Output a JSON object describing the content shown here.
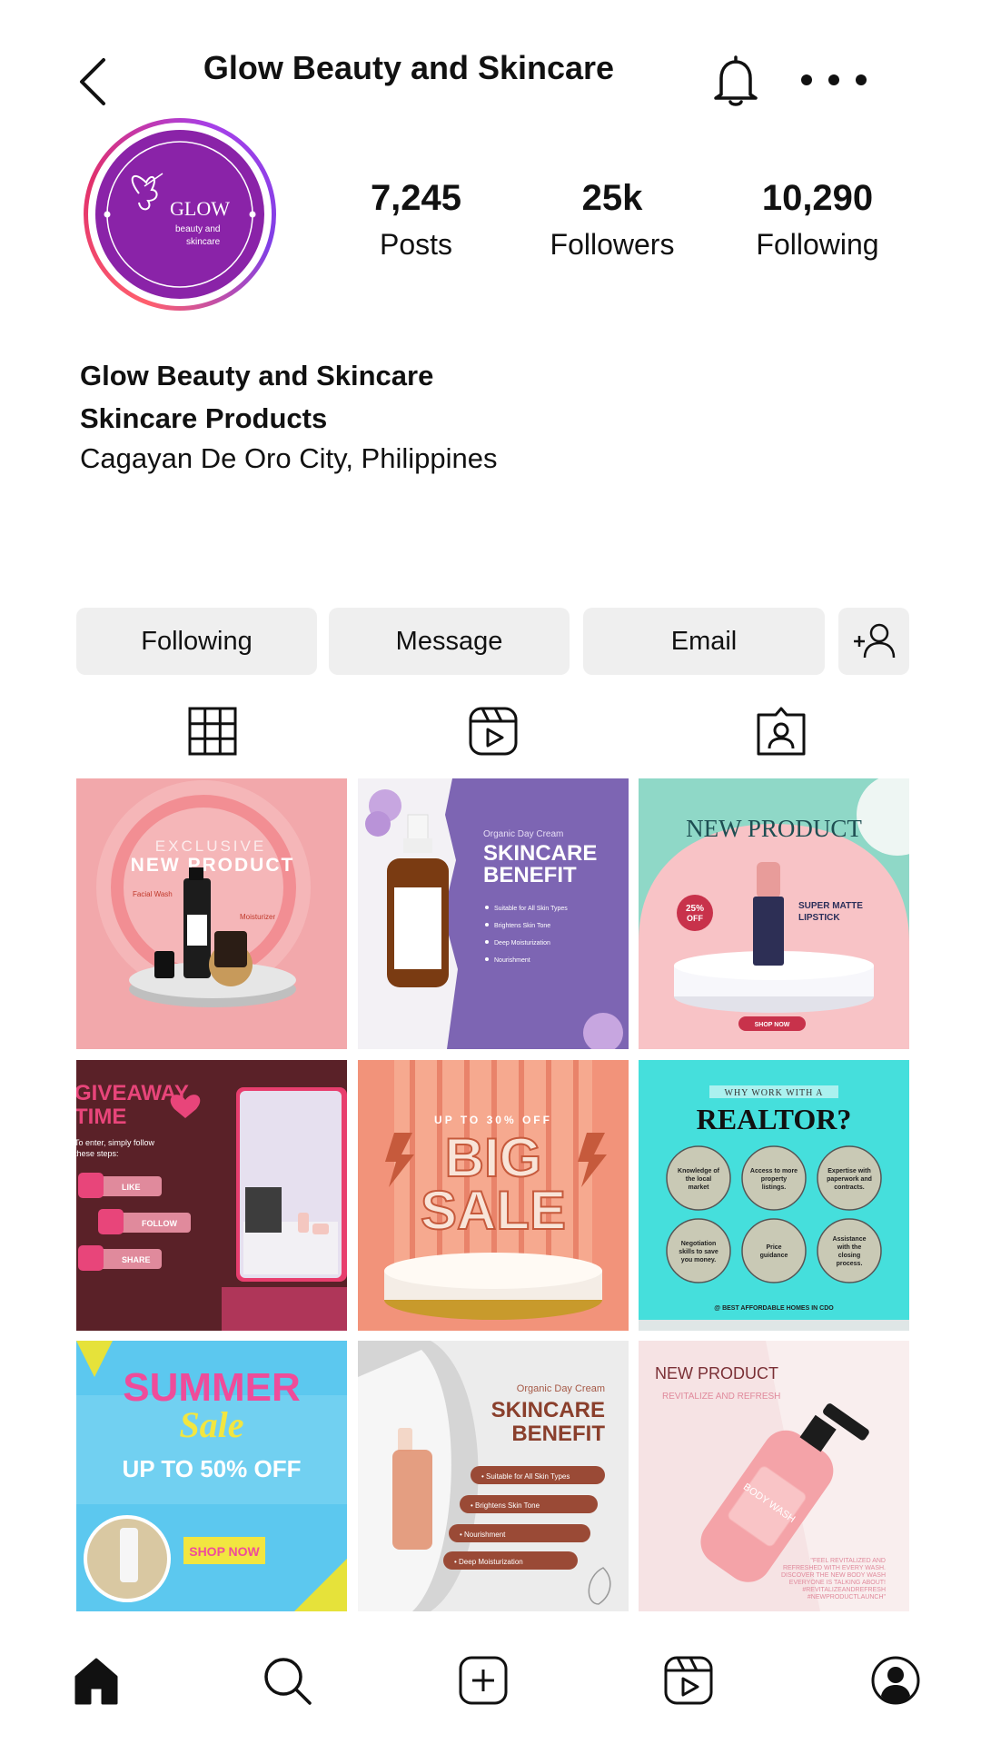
{
  "header": {
    "title": "Glow Beauty and Skincare",
    "back_icon": "back-arrow-icon",
    "bell_icon": "bell-icon",
    "more_icon": "more-dots-icon"
  },
  "avatar": {
    "brand": "GLOW",
    "line1": "beauty and",
    "line2": "skincare"
  },
  "stats": [
    {
      "value": "7,245",
      "label": "Posts"
    },
    {
      "value": "25k",
      "label": "Followers"
    },
    {
      "value": "10,290",
      "label": "Following"
    }
  ],
  "bio": {
    "name": "Glow Beauty and Skincare",
    "category": "Skincare Products",
    "location": "Cagayan De Oro City, Philippines"
  },
  "actions": {
    "following": "Following",
    "message": "Message",
    "email": "Email",
    "add_icon": "add-person-icon"
  },
  "tabs": [
    "grid-icon",
    "reels-icon",
    "tagged-icon"
  ],
  "posts": [
    {
      "eyebrow": "EXCLUSIVE",
      "title": "NEW PRODUCT",
      "tag1": "Facial Wash",
      "tag2": "Moisturizer"
    },
    {
      "eyebrow": "Organic Day Cream",
      "title1": "SKINCARE",
      "title2": "BENEFIT",
      "bullets": [
        "Suitable for All Skin Types",
        "Brightens Skin Tone",
        "Deep Moisturization",
        "Nourishment"
      ]
    },
    {
      "title": "NEW PRODUCT",
      "badge1": "25%",
      "badge2": "OFF",
      "label1": "SUPER MATTE",
      "label2": "LIPSTICK",
      "cta": "SHOP NOW"
    },
    {
      "title1": "GIVEAWAY",
      "title2": "TIME",
      "intro1": "To enter, simply follow",
      "intro2": "these steps:",
      "steps": [
        "LIKE",
        "FOLLOW",
        "SHARE"
      ]
    },
    {
      "eyebrow": "UP TO 30% OFF",
      "title1": "BIG",
      "title2": "SALE"
    },
    {
      "eyebrow": "WHY WORK WITH A",
      "title": "REALTOR?",
      "circles": [
        [
          "Knowledge of",
          "the local",
          "market"
        ],
        [
          "Access to more",
          "property",
          "listings."
        ],
        [
          "Expertise with",
          "paperwork and",
          "contracts."
        ],
        [
          "Negotiation",
          "skills to save",
          "you money."
        ],
        [
          "Price",
          "guidance"
        ],
        [
          "Assistance",
          "with the",
          "closing",
          "process."
        ]
      ],
      "footer": "@ BEST AFFORDABLE HOMES IN CDO"
    },
    {
      "title1": "SUMMER",
      "title2": "Sale",
      "offer": "UP TO 50% OFF",
      "cta": "SHOP NOW"
    },
    {
      "eyebrow": "Organic Day Cream",
      "title1": "SKINCARE",
      "title2": "BENEFIT",
      "bullets": [
        "• Suitable for All Skin Types",
        "• Brightens Skin Tone",
        "• Nourishment",
        "• Deep Moisturization"
      ]
    },
    {
      "title": "NEW PRODUCT",
      "subtitle": "REVITALIZE AND REFRESH",
      "bottle": "BODY WASH",
      "quote": [
        "\"FEEL REVITALIZED AND",
        "REFRESHED WITH EVERY WASH.",
        "DISCOVER THE NEW BODY WASH",
        "EVERYONE IS TALKING ABOUT!",
        "#REVITALIZEANDREFRESH",
        "#NEWPRODUCTLAUNCH\""
      ]
    }
  ],
  "bottom_nav": [
    "home-icon",
    "search-icon",
    "create-post-icon",
    "reels-icon",
    "profile-icon"
  ],
  "colors": {
    "accent_purple": "#8a23a8",
    "button_bg": "#efefef",
    "text": "#111111"
  }
}
